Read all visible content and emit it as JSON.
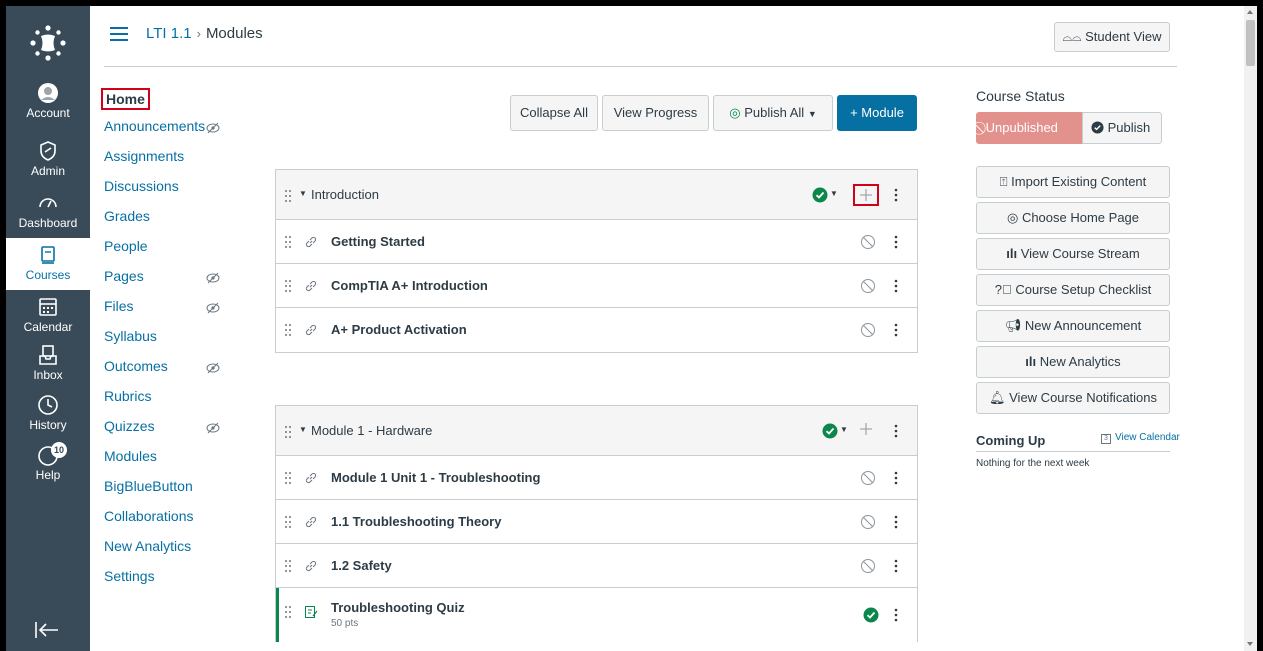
{
  "global_nav": {
    "items": [
      {
        "label": "Account",
        "icon": "account-icon"
      },
      {
        "label": "Admin",
        "icon": "admin-icon"
      },
      {
        "label": "Dashboard",
        "icon": "dashboard-icon"
      },
      {
        "label": "Courses",
        "icon": "courses-icon",
        "active": true
      },
      {
        "label": "Calendar",
        "icon": "calendar-icon"
      },
      {
        "label": "Inbox",
        "icon": "inbox-icon"
      },
      {
        "label": "History",
        "icon": "history-icon"
      },
      {
        "label": "Help",
        "icon": "help-icon",
        "badge": "10"
      }
    ]
  },
  "breadcrumb": {
    "course": "LTI 1.1",
    "separator": "›",
    "page": "Modules"
  },
  "header": {
    "student_view": "Student View"
  },
  "course_nav": {
    "items": [
      {
        "label": "Home"
      },
      {
        "label": "Announcements"
      },
      {
        "label": "Assignments"
      },
      {
        "label": "Discussions"
      },
      {
        "label": "Grades"
      },
      {
        "label": "People"
      },
      {
        "label": "Pages"
      },
      {
        "label": "Files"
      },
      {
        "label": "Syllabus"
      },
      {
        "label": "Outcomes"
      },
      {
        "label": "Rubrics"
      },
      {
        "label": "Quizzes"
      },
      {
        "label": "Modules"
      },
      {
        "label": "BigBlueButton"
      },
      {
        "label": "Collaborations"
      },
      {
        "label": "New Analytics"
      },
      {
        "label": "Settings"
      }
    ]
  },
  "toolbar": {
    "collapse_all": "Collapse All",
    "view_progress": "View Progress",
    "publish_all": "Publish All",
    "add_module": "+ Module"
  },
  "modules": [
    {
      "title": "Introduction",
      "items": [
        {
          "title": "Getting Started"
        },
        {
          "title": "CompTIA A+ Introduction"
        },
        {
          "title": "A+ Product Activation"
        }
      ]
    },
    {
      "title": "Module 1 - Hardware",
      "items": [
        {
          "title": "Module 1 Unit 1 - Troubleshooting"
        },
        {
          "title": "1.1 Troubleshooting Theory"
        },
        {
          "title": "1.2 Safety"
        },
        {
          "title": "Troubleshooting Quiz",
          "sub": "50 pts"
        }
      ]
    }
  ],
  "sidebar": {
    "course_status": "Course Status",
    "unpublished": "Unpublished",
    "publish": "Publish",
    "buttons": [
      "Import Existing Content",
      "Choose Home Page",
      "View Course Stream",
      "Course Setup Checklist",
      "New Announcement",
      "New Analytics",
      "View Course Notifications"
    ],
    "coming_up": "Coming Up",
    "view_calendar": "View Calendar",
    "nothing": "Nothing for the next week"
  },
  "colors": {
    "nav_bg": "#394b58",
    "link": "#0770a3",
    "primary": "#0770a3",
    "success": "#0b874b",
    "unpublished": "#e3918c",
    "highlight": "#d0021b"
  }
}
